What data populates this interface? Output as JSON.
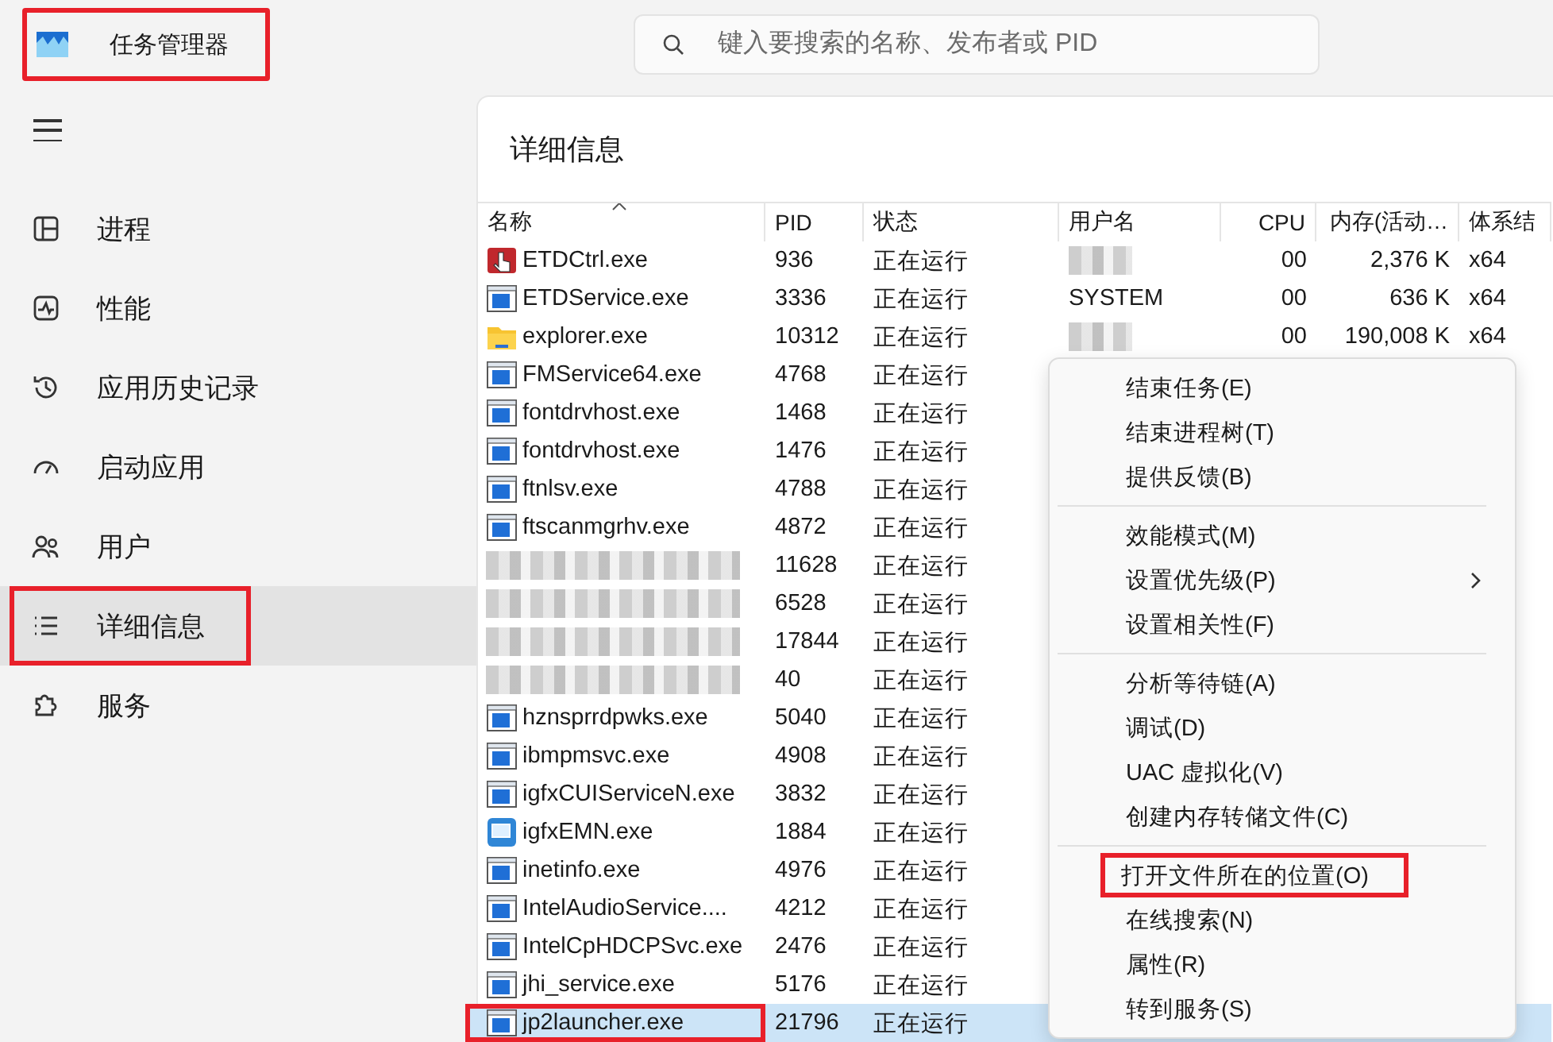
{
  "window": {
    "title": "任务管理器",
    "title_highlighted": true
  },
  "search": {
    "placeholder": "键入要搜索的名称、发布者或 PID"
  },
  "sidebar": {
    "items": [
      {
        "label": "进程",
        "selected": false,
        "highlighted": false
      },
      {
        "label": "性能",
        "selected": false,
        "highlighted": false
      },
      {
        "label": "应用历史记录",
        "selected": false,
        "highlighted": false
      },
      {
        "label": "启动应用",
        "selected": false,
        "highlighted": false
      },
      {
        "label": "用户",
        "selected": false,
        "highlighted": false
      },
      {
        "label": "详细信息",
        "selected": true,
        "highlighted": true
      },
      {
        "label": "服务",
        "selected": false,
        "highlighted": false
      }
    ]
  },
  "page_title": "详细信息",
  "table": {
    "columns": [
      {
        "label": "名称",
        "sorted": true
      },
      {
        "label": "PID",
        "sorted": false
      },
      {
        "label": "状态",
        "sorted": false
      },
      {
        "label": "用户名",
        "sorted": false
      },
      {
        "label": "CPU",
        "sorted": false
      },
      {
        "label": "内存(活动…",
        "sorted": false
      },
      {
        "label": "体系结",
        "sorted": false
      }
    ],
    "rows": [
      {
        "kind": "ctrl",
        "name": "ETDCtrl.exe",
        "pid": "936",
        "status": "正在运行",
        "user_blurred": true,
        "cpu": "00",
        "memory": "2,376 K",
        "arch": "x64",
        "selected": false,
        "highlighted": false
      },
      {
        "kind": "app",
        "name": "ETDService.exe",
        "pid": "3336",
        "status": "正在运行",
        "user": "SYSTEM",
        "cpu": "00",
        "memory": "636 K",
        "arch": "x64",
        "selected": false,
        "highlighted": false
      },
      {
        "kind": "folder",
        "name": "explorer.exe",
        "pid": "10312",
        "status": "正在运行",
        "user_blurred": true,
        "cpu": "00",
        "memory": "190,008 K",
        "arch": "x64",
        "selected": false,
        "highlighted": false
      },
      {
        "kind": "app",
        "name": "FMService64.exe",
        "pid": "4768",
        "status": "正在运行",
        "selected": false,
        "highlighted": false
      },
      {
        "kind": "app",
        "name": "fontdrvhost.exe",
        "pid": "1468",
        "status": "正在运行",
        "selected": false,
        "highlighted": false
      },
      {
        "kind": "app",
        "name": "fontdrvhost.exe",
        "pid": "1476",
        "status": "正在运行",
        "selected": false,
        "highlighted": false
      },
      {
        "kind": "app",
        "name": "ftnlsv.exe",
        "pid": "4788",
        "status": "正在运行",
        "selected": false,
        "highlighted": false
      },
      {
        "kind": "app",
        "name": "ftscanmgrhv.exe",
        "pid": "4872",
        "status": "正在运行",
        "selected": false,
        "highlighted": false
      },
      {
        "kind": "blurred",
        "pid": "11628",
        "status": "正在运行",
        "selected": false,
        "highlighted": false
      },
      {
        "kind": "blurred",
        "pid": "6528",
        "status": "正在运行",
        "selected": false,
        "highlighted": false
      },
      {
        "kind": "blurred",
        "pid": "17844",
        "status": "正在运行",
        "selected": false,
        "highlighted": false
      },
      {
        "kind": "blurred",
        "pid": "40",
        "status": "正在运行",
        "selected": false,
        "highlighted": false
      },
      {
        "kind": "app",
        "name": "hznsprrdpwks.exe",
        "pid": "5040",
        "status": "正在运行",
        "selected": false,
        "highlighted": false
      },
      {
        "kind": "app",
        "name": "ibmpmsvc.exe",
        "pid": "4908",
        "status": "正在运行",
        "selected": false,
        "highlighted": false
      },
      {
        "kind": "app",
        "name": "igfxCUIServiceN.exe",
        "pid": "3832",
        "status": "正在运行",
        "selected": false,
        "highlighted": false
      },
      {
        "kind": "igfx",
        "name": "igfxEMN.exe",
        "pid": "1884",
        "status": "正在运行",
        "selected": false,
        "highlighted": false
      },
      {
        "kind": "app",
        "name": "inetinfo.exe",
        "pid": "4976",
        "status": "正在运行",
        "selected": false,
        "highlighted": false
      },
      {
        "kind": "app",
        "name": "IntelAudioService....",
        "pid": "4212",
        "status": "正在运行",
        "selected": false,
        "highlighted": false
      },
      {
        "kind": "app",
        "name": "IntelCpHDCPSvc.exe",
        "pid": "2476",
        "status": "正在运行",
        "selected": false,
        "highlighted": false
      },
      {
        "kind": "app",
        "name": "jhi_service.exe",
        "pid": "5176",
        "status": "正在运行",
        "selected": false,
        "highlighted": false
      },
      {
        "kind": "app",
        "name": "jp2launcher.exe",
        "pid": "21796",
        "status": "正在运行",
        "selected": true,
        "highlighted": true
      }
    ]
  },
  "context_menu": {
    "groups": [
      [
        {
          "label": "结束任务(E)",
          "submenu": false,
          "highlighted": false
        },
        {
          "label": "结束进程树(T)",
          "submenu": false,
          "highlighted": false
        },
        {
          "label": "提供反馈(B)",
          "submenu": false,
          "highlighted": false
        }
      ],
      [
        {
          "label": "效能模式(M)",
          "submenu": false,
          "highlighted": false
        },
        {
          "label": "设置优先级(P)",
          "submenu": true,
          "highlighted": false
        },
        {
          "label": "设置相关性(F)",
          "submenu": false,
          "highlighted": false
        }
      ],
      [
        {
          "label": "分析等待链(A)",
          "submenu": false,
          "highlighted": false
        },
        {
          "label": "调试(D)",
          "submenu": false,
          "highlighted": false
        },
        {
          "label": "UAC 虚拟化(V)",
          "submenu": false,
          "highlighted": false
        },
        {
          "label": "创建内存转储文件(C)",
          "submenu": false,
          "highlighted": false
        }
      ],
      [
        {
          "label": "打开文件所在的位置(O)",
          "submenu": false,
          "highlighted": true
        },
        {
          "label": "在线搜索(N)",
          "submenu": false,
          "highlighted": false
        },
        {
          "label": "属性(R)",
          "submenu": false,
          "highlighted": false
        },
        {
          "label": "转到服务(S)",
          "submenu": false,
          "highlighted": false
        }
      ]
    ]
  }
}
